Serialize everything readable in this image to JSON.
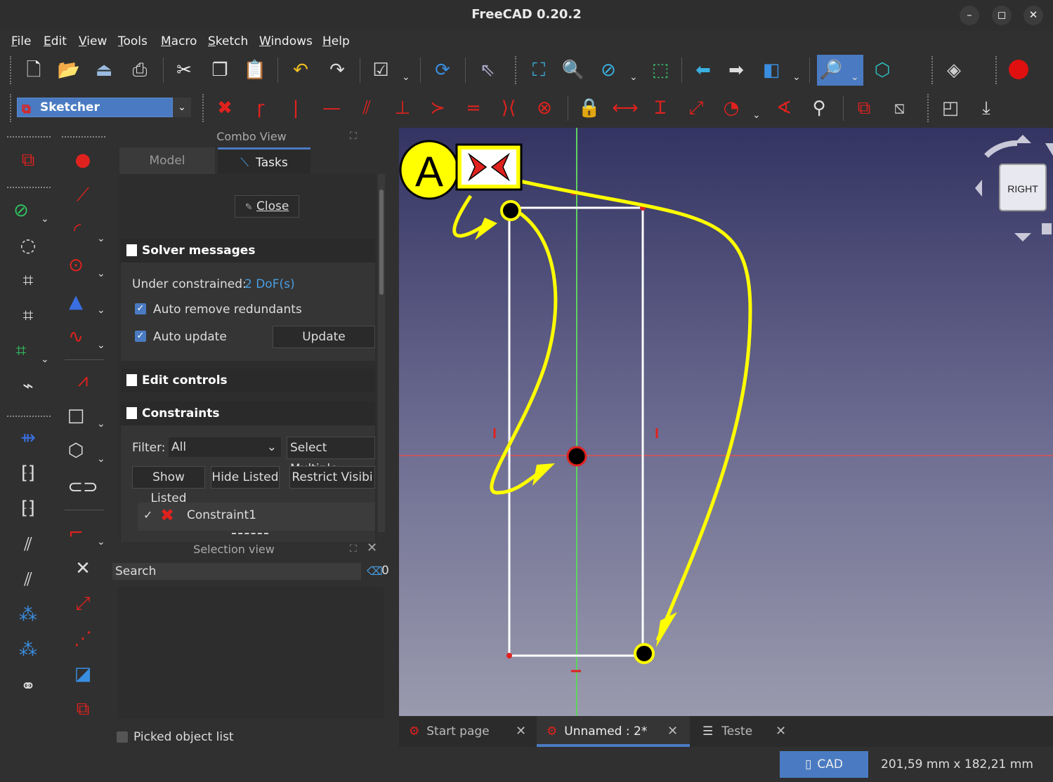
{
  "window": {
    "title": "FreeCAD 0.20.2",
    "minimize": "–",
    "maximize": "◻",
    "close": "✕"
  },
  "menu": [
    "File",
    "Edit",
    "View",
    "Tools",
    "Macro",
    "Sketch",
    "Windows",
    "Help"
  ],
  "workbench": {
    "label": "Sketcher"
  },
  "combo_view": {
    "title": "Combo View",
    "tabs": [
      "Model",
      "Tasks"
    ],
    "close_label": "Close",
    "solver": {
      "header": "Solver messages",
      "status_label": "Under constrained:",
      "status_value": "2 DoF(s)",
      "auto_remove": "Auto remove redundants",
      "auto_update": "Auto update",
      "update_button": "Update"
    },
    "edit_controls": "Edit controls",
    "constraints": {
      "header": "Constraints",
      "filter_label": "Filter:",
      "filter_value": "All",
      "select_multiple": "Select Multiple",
      "show_listed": "Show Listed",
      "hide_listed": "Hide Listed",
      "restrict": "Restrict Visibi",
      "items": [
        "Constraint1"
      ]
    }
  },
  "selection_view": {
    "title": "Selection view",
    "search_placeholder": "Search",
    "count": "0",
    "picked_list": "Picked object list"
  },
  "navcube": {
    "face": "RIGHT"
  },
  "annotation": {
    "letter": "A"
  },
  "doc_tabs": [
    {
      "label": "Start page"
    },
    {
      "label": "Unnamed : 2*"
    },
    {
      "label": "Teste"
    }
  ],
  "status": {
    "nav_style": "CAD",
    "dimensions": "201,59 mm x 182,21 mm"
  },
  "colors": {
    "accent": "#4a7bc2",
    "constraint_red": "#e0221e",
    "annotation_yellow": "#ffff00",
    "axis_green": "#5fd35f"
  }
}
